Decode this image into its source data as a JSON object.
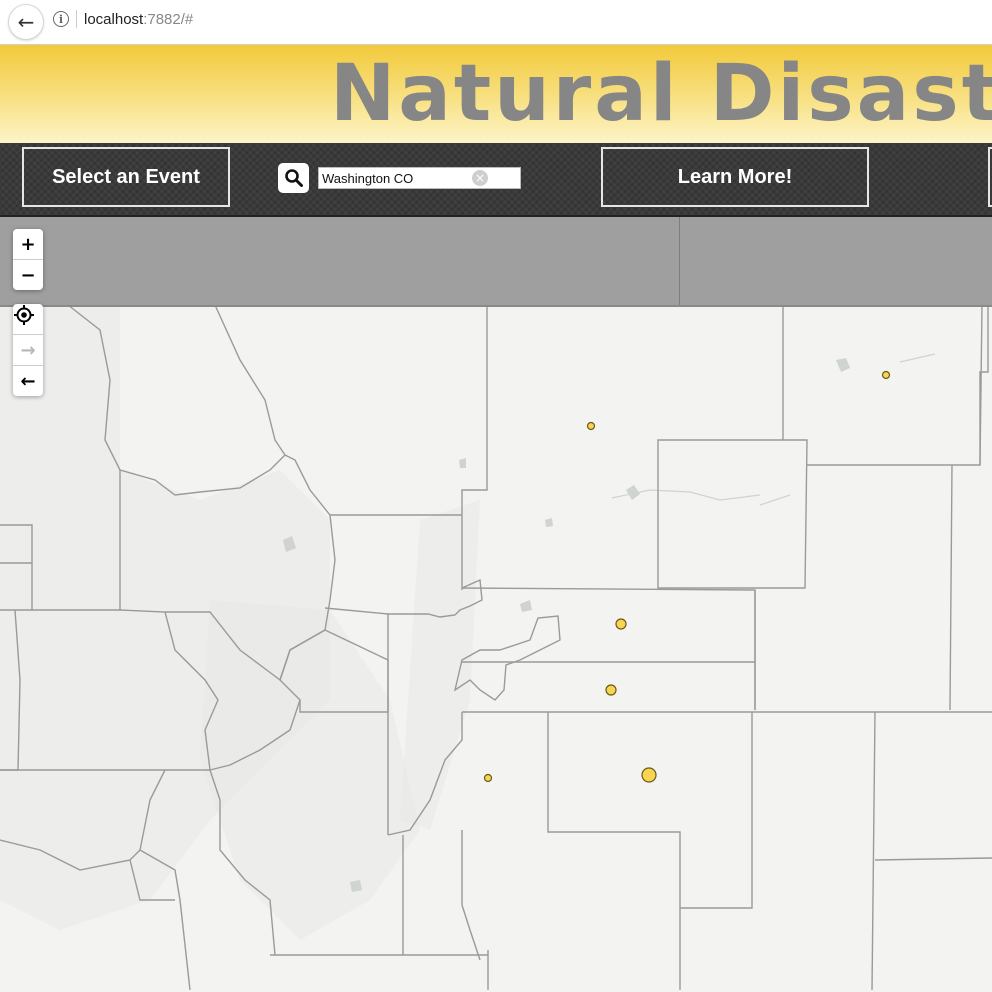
{
  "browser": {
    "url_host": "localhost",
    "url_rest": ":7882/#",
    "back_icon": "arrow-left-icon",
    "info_icon": "info-icon"
  },
  "banner": {
    "title": "Natural Disaste"
  },
  "toolbar": {
    "select_event_label": "Select an Event",
    "search_value": "Washington CO",
    "learn_more_label": "Learn More!"
  },
  "map_controls": {
    "zoom_in": "+",
    "zoom_out": "−"
  },
  "colors": {
    "banner_top": "#f2c93a",
    "banner_bottom": "#fdf4c8",
    "toolbar_bg": "#3a3a3a",
    "event_marker": "#f7d553",
    "county_border": "#9a9a9a"
  },
  "event_markers": [
    {
      "size": "small"
    },
    {
      "size": "small"
    },
    {
      "size": "medium"
    },
    {
      "size": "medium"
    },
    {
      "size": "small"
    },
    {
      "size": "large"
    }
  ]
}
